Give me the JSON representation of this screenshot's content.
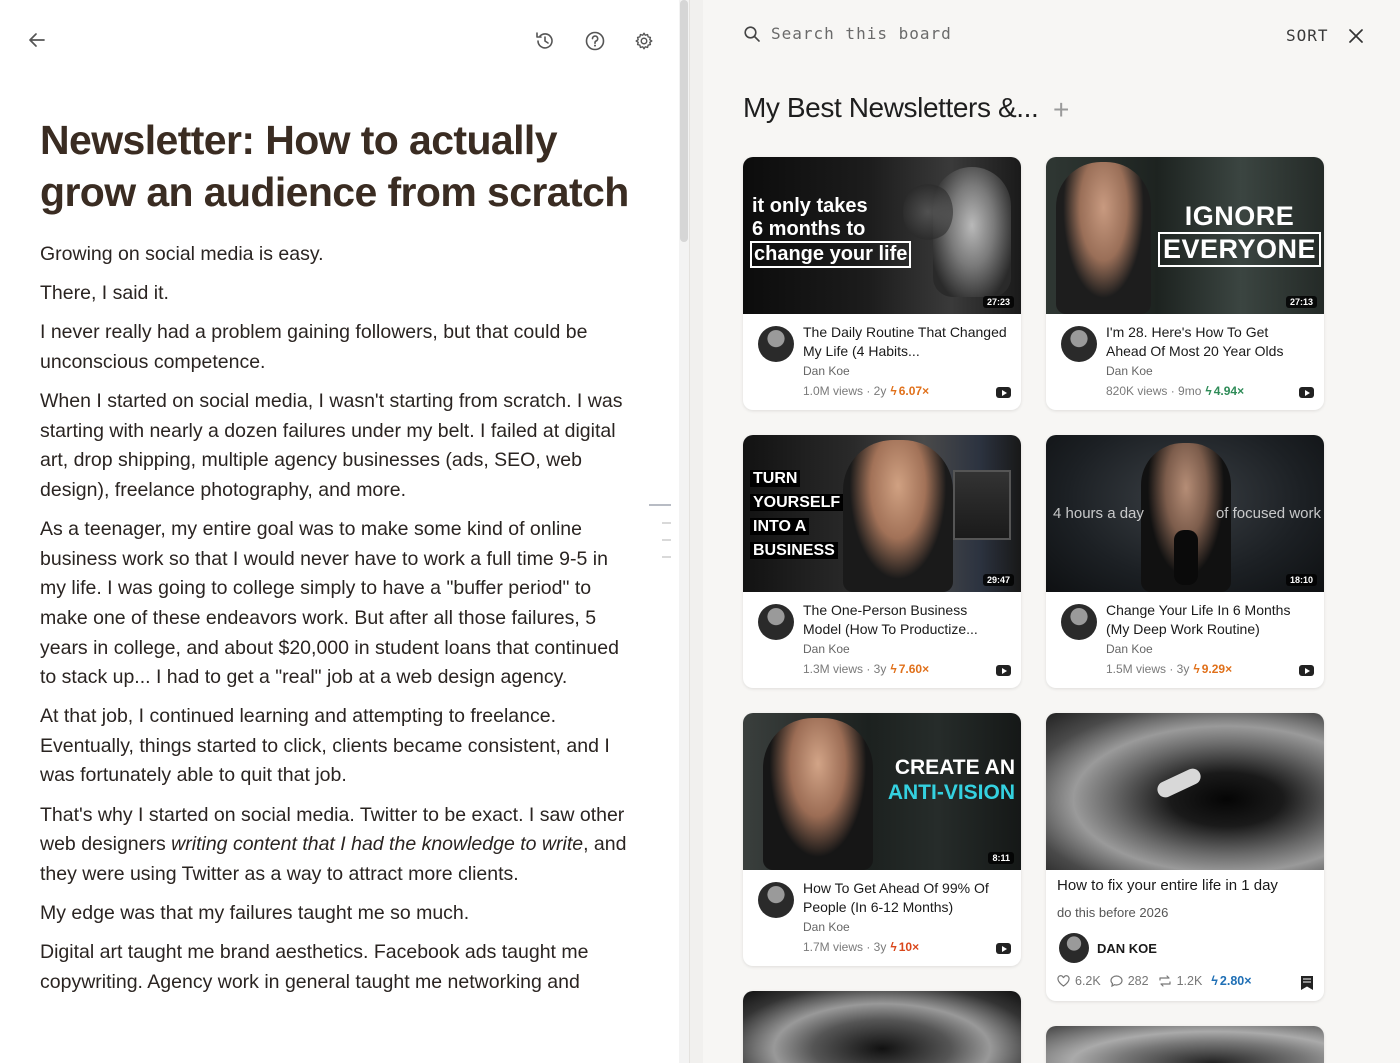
{
  "editor": {
    "back_icon": "arrow-left-icon",
    "history_icon": "history-icon",
    "help_icon": "help-circle-icon",
    "settings_icon": "gear-icon",
    "title": "Newsletter: How to actually grow an audience from scratch",
    "paragraphs": {
      "p1": "Growing on social media is easy.",
      "p2": "There, I said it.",
      "p3": "I never really had a problem gaining followers, but that could be unconscious competence.",
      "p4": "When I started on social media, I wasn't starting from scratch. I was starting with nearly a dozen failures under my belt. I failed at digital art, drop shipping, multiple agency businesses (ads, SEO, web design), freelance photography, and more.",
      "p5": "As a teenager, my entire goal was to make some kind of online business work so that I would never have to work a full time 9-5 in my life. I was going to college simply to have a \"buffer period\" to make one of these endeavors work. But after all those failures, 5 years in college, and about $20,000 in student loans that continued to stack up... I had to get a \"real\" job at a web design agency.",
      "p6": "At that job, I continued learning and attempting to freelance. Eventually, things started to click, clients became consistent, and I was fortunately able to quit that job.",
      "p7a": "That's why I started on social media. Twitter to be exact. I saw other web designers ",
      "p7b": "writing content that I had the knowledge to write",
      "p7c": ", and they were using Twitter as a way to attract more clients.",
      "p8": "My edge was that my failures taught me so much.",
      "p9": "Digital art taught me brand aesthetics. Facebook ads taught me copywriting. Agency work in general taught me networking and"
    }
  },
  "board": {
    "search_icon": "search-icon",
    "search_placeholder": "Search this board",
    "sort_label": "SORT",
    "close_icon": "close-icon",
    "title": "My Best Newsletters &...",
    "add_icon": "plus-icon",
    "cards": [
      {
        "thumb_lines": [
          "it only takes",
          "6 months to",
          "change your life"
        ],
        "duration": "27:23",
        "title": "The Daily Routine That Changed My Life (4 Habits...",
        "channel": "Dan Koe",
        "views": "1.0M views · 2y",
        "multiplier": "6.07×",
        "mult_color": "#e0701a"
      },
      {
        "thumb_lines": [
          "IGNORE",
          "EVERYONE"
        ],
        "duration": "27:13",
        "title": "I'm 28. Here's How To Get Ahead Of Most 20 Year Olds",
        "channel": "Dan Koe",
        "views": "820K views · 9mo",
        "multiplier": "4.94×",
        "mult_color": "#2e8b57"
      },
      {
        "thumb_lines": [
          "TURN",
          "YOURSELF",
          "INTO A",
          "BUSINESS"
        ],
        "duration": "29:47",
        "title": "The One-Person Business Model (How To Productize...",
        "channel": "Dan Koe",
        "views": "1.3M views · 3y",
        "multiplier": "7.60×",
        "mult_color": "#e0701a"
      },
      {
        "thumb_lines": [
          "4 hours a day",
          "of focused work"
        ],
        "duration": "18:10",
        "title": "Change Your Life In 6 Months (My Deep Work Routine)",
        "channel": "Dan Koe",
        "views": "1.5M views · 3y",
        "multiplier": "9.29×",
        "mult_color": "#e0701a"
      },
      {
        "thumb_lines": [
          "CREATE AN",
          "ANTI-VISION"
        ],
        "duration": "8:11",
        "title": "How To Get Ahead Of 99% Of People (In 6-12 Months)",
        "channel": "Dan Koe",
        "views": "1.7M views · 3y",
        "multiplier": "10×",
        "mult_color": "#d9461a"
      }
    ],
    "article_card": {
      "title": "How to fix your entire life in 1 day",
      "subtitle": "do this before 2026",
      "author": "DAN KOE",
      "likes": "6.2K",
      "comments": "282",
      "restacks": "1.2K",
      "multiplier": "2.80×",
      "mult_color": "#1f6fb5",
      "bookmark_icon": "bookmark-icon"
    }
  }
}
